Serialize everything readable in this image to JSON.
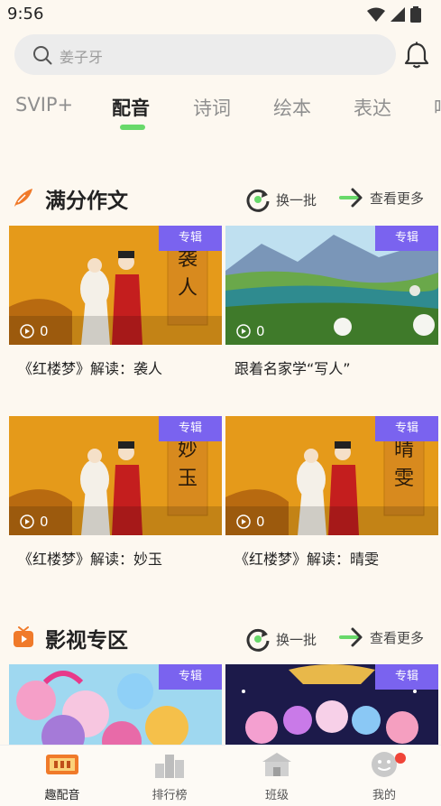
{
  "status": {
    "time": "9:56"
  },
  "search": {
    "placeholder": "姜子牙"
  },
  "tabs": [
    {
      "label": "SVIP+"
    },
    {
      "label": "配音"
    },
    {
      "label": "诗词"
    },
    {
      "label": "绘本"
    },
    {
      "label": "表达"
    },
    {
      "label": "吗"
    }
  ],
  "section1": {
    "title": "满分作文",
    "refresh_label": "换一批",
    "more_label": "查看更多",
    "cards": [
      {
        "badge": "专辑",
        "plays": "0",
        "title": "《红楼梦》解读：袭人",
        "calligraphy": "袭人"
      },
      {
        "badge": "专辑",
        "plays": "0",
        "title": "跟着名家学“写人”"
      },
      {
        "badge": "专辑",
        "plays": "0",
        "title": "《红楼梦》解读：妙玉",
        "calligraphy": "妙玉"
      },
      {
        "badge": "专辑",
        "plays": "0",
        "title": "《红楼梦》解读：晴雯",
        "calligraphy": "晴雯"
      }
    ]
  },
  "section2": {
    "title": "影视专区",
    "refresh_label": "换一批",
    "more_label": "查看更多",
    "cards": [
      {
        "badge": "专辑"
      },
      {
        "badge": "专辑"
      }
    ]
  },
  "nav": [
    {
      "label": "趣配音",
      "icon": "dub-icon"
    },
    {
      "label": "排行榜",
      "icon": "ranking-icon"
    },
    {
      "label": "班级",
      "icon": "class-icon"
    },
    {
      "label": "我的",
      "icon": "profile-icon"
    }
  ],
  "colors": {
    "accent": "#68d96a",
    "badge": "#7a63ef",
    "orange": "#f07a2a"
  }
}
